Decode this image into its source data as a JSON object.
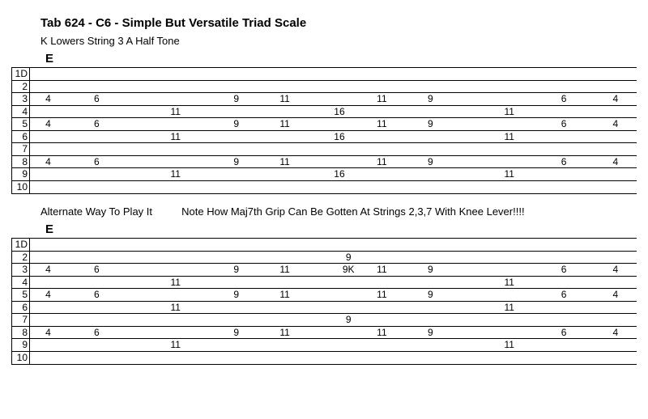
{
  "title": "Tab 624 - C6 - Simple But Versatile Triad Scale",
  "subtitle": "K Lowers String 3 A Half Tone",
  "alt_note": "Alternate Way To Play It          Note How Maj7th Grip Can Be Gotten At Strings 2,3,7 With Knee Lever!!!!",
  "chord_label_1": "E",
  "chord_label_2": "E",
  "string_labels": [
    "1D",
    "2",
    "3",
    "4",
    "5",
    "6",
    "7",
    "8",
    "9",
    "10"
  ],
  "tab1": {
    "s1": [],
    "s2": [],
    "s3": [
      [
        "c1",
        "4"
      ],
      [
        "c2",
        "6"
      ],
      [
        "c4",
        "9"
      ],
      [
        "c5",
        "11"
      ],
      [
        "c7",
        "11"
      ],
      [
        "c8",
        "9"
      ],
      [
        "c10",
        "6"
      ],
      [
        "c11",
        "4"
      ]
    ],
    "s4": [
      [
        "c3",
        "11"
      ],
      [
        "c6",
        "16"
      ],
      [
        "c9",
        "11"
      ]
    ],
    "s5": [
      [
        "c1",
        "4"
      ],
      [
        "c2",
        "6"
      ],
      [
        "c4",
        "9"
      ],
      [
        "c5",
        "11"
      ],
      [
        "c7",
        "11"
      ],
      [
        "c8",
        "9"
      ],
      [
        "c10",
        "6"
      ],
      [
        "c11",
        "4"
      ]
    ],
    "s6": [
      [
        "c3",
        "11"
      ],
      [
        "c6",
        "16"
      ],
      [
        "c9",
        "11"
      ]
    ],
    "s7": [],
    "s8": [
      [
        "c1",
        "4"
      ],
      [
        "c2",
        "6"
      ],
      [
        "c4",
        "9"
      ],
      [
        "c5",
        "11"
      ],
      [
        "c7",
        "11"
      ],
      [
        "c8",
        "9"
      ],
      [
        "c10",
        "6"
      ],
      [
        "c11",
        "4"
      ]
    ],
    "s9": [
      [
        "c3",
        "11"
      ],
      [
        "c6",
        "16"
      ],
      [
        "c9",
        "11"
      ]
    ],
    "s10": []
  },
  "tab2": {
    "s1": [],
    "s2": [
      [
        "c6b",
        "9"
      ]
    ],
    "s3": [
      [
        "c1",
        "4"
      ],
      [
        "c2",
        "6"
      ],
      [
        "c4",
        "9"
      ],
      [
        "c5",
        "11"
      ],
      [
        "c6b",
        "9K"
      ],
      [
        "c7",
        "11"
      ],
      [
        "c8",
        "9"
      ],
      [
        "c10",
        "6"
      ],
      [
        "c11",
        "4"
      ]
    ],
    "s4": [
      [
        "c3",
        "11"
      ],
      [
        "c9",
        "11"
      ]
    ],
    "s5": [
      [
        "c1",
        "4"
      ],
      [
        "c2",
        "6"
      ],
      [
        "c4",
        "9"
      ],
      [
        "c5",
        "11"
      ],
      [
        "c7",
        "11"
      ],
      [
        "c8",
        "9"
      ],
      [
        "c10",
        "6"
      ],
      [
        "c11",
        "4"
      ]
    ],
    "s6": [
      [
        "c3",
        "11"
      ],
      [
        "c9",
        "11"
      ]
    ],
    "s7": [
      [
        "c6b",
        "9"
      ]
    ],
    "s8": [
      [
        "c1",
        "4"
      ],
      [
        "c2",
        "6"
      ],
      [
        "c4",
        "9"
      ],
      [
        "c5",
        "11"
      ],
      [
        "c7",
        "11"
      ],
      [
        "c8",
        "9"
      ],
      [
        "c10",
        "6"
      ],
      [
        "c11",
        "4"
      ]
    ],
    "s9": [
      [
        "c3",
        "11"
      ],
      [
        "c9",
        "11"
      ]
    ],
    "s10": []
  }
}
